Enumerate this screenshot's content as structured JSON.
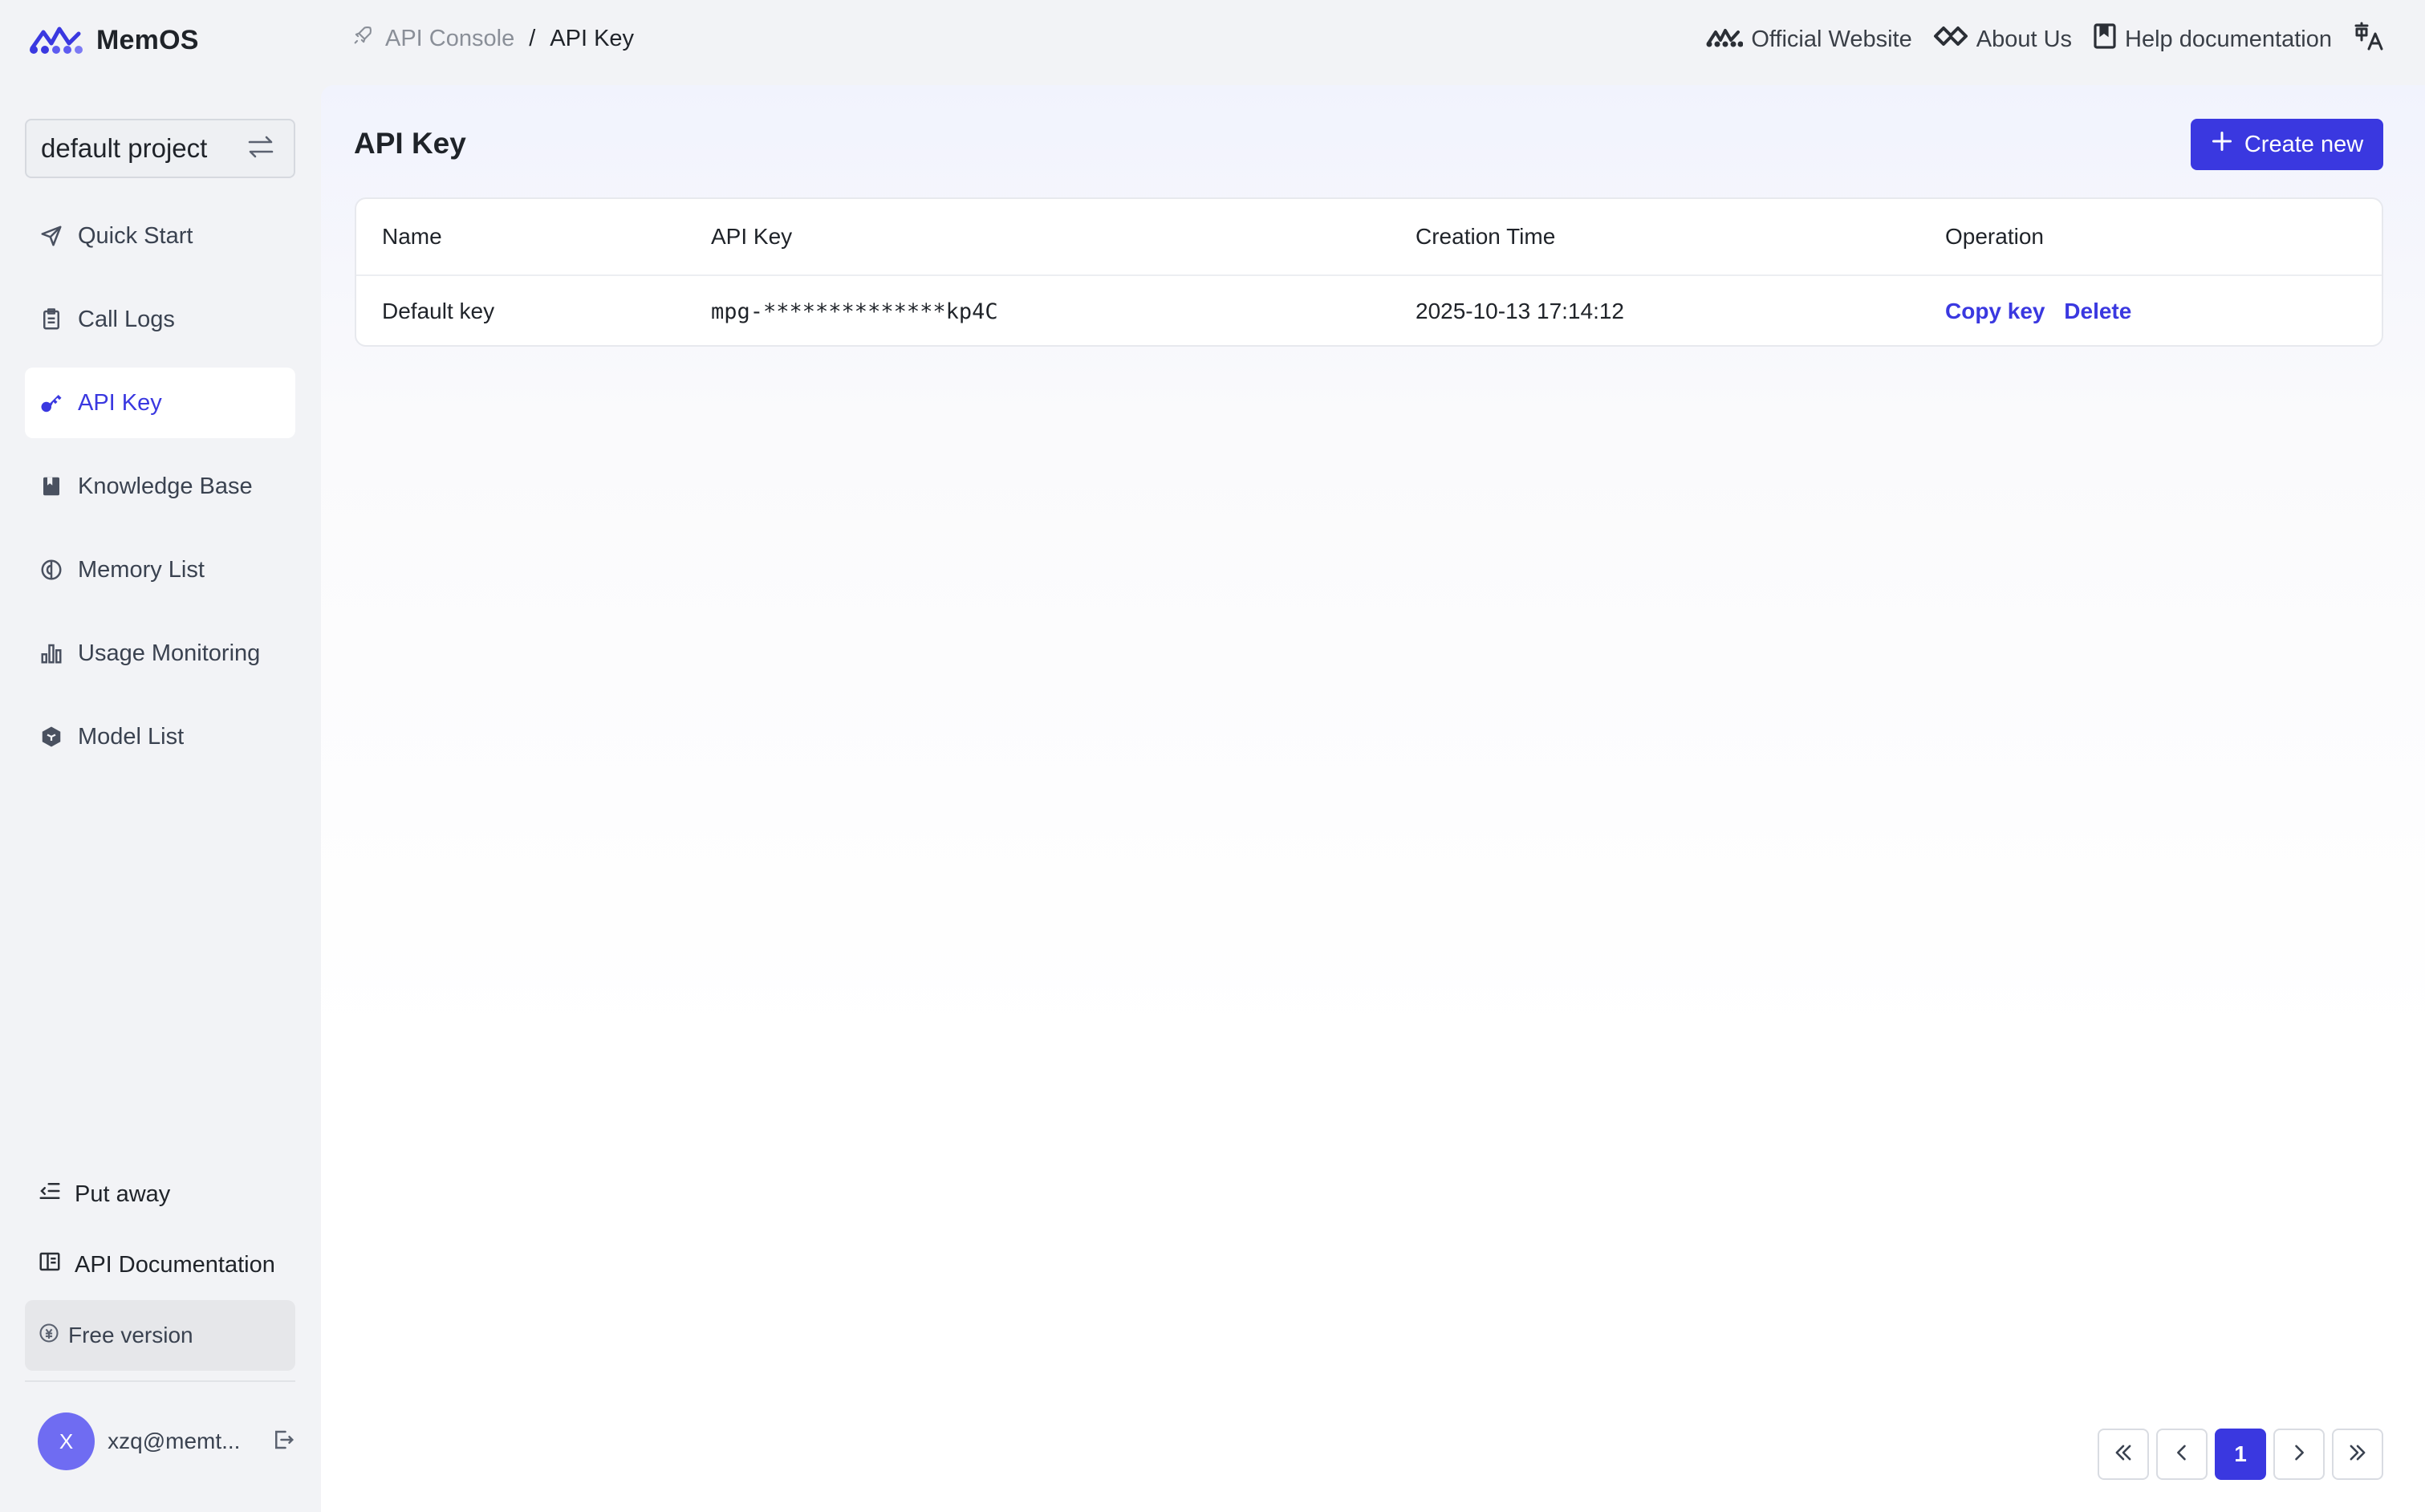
{
  "app": {
    "brand": "MemOS",
    "accent_color": "#3a38e0"
  },
  "breadcrumb": {
    "parent": "API Console",
    "separator": "/",
    "current": "API Key"
  },
  "top_links": {
    "official_website": "Official Website",
    "about_us": "About Us",
    "help_docs": "Help documentation",
    "language_icon": "translate-icon"
  },
  "sidebar": {
    "project": "default project",
    "items": [
      {
        "label": "Quick Start",
        "icon": "send-icon",
        "active": false
      },
      {
        "label": "Call Logs",
        "icon": "clipboard-icon",
        "active": false
      },
      {
        "label": "API Key",
        "icon": "key-icon",
        "active": true
      },
      {
        "label": "Knowledge Base",
        "icon": "book-icon",
        "active": false
      },
      {
        "label": "Memory List",
        "icon": "brain-icon",
        "active": false
      },
      {
        "label": "Usage Monitoring",
        "icon": "bar-chart-icon",
        "active": false
      },
      {
        "label": "Model List",
        "icon": "cube-icon",
        "active": false
      }
    ],
    "put_away": "Put away",
    "api_documentation": "API Documentation",
    "plan": "Free version",
    "user": {
      "initial": "X",
      "email": "xzq@memt..."
    }
  },
  "main": {
    "title": "API Key",
    "create_button": "Create new",
    "table": {
      "columns": [
        "Name",
        "API Key",
        "Creation Time",
        "Operation"
      ],
      "rows": [
        {
          "name": "Default key",
          "api_key": "mpg-**************kp4C",
          "created": "2025-10-13 17:14:12",
          "actions": [
            "Copy key",
            "Delete"
          ]
        }
      ]
    },
    "pagination": {
      "current_page": "1"
    }
  }
}
